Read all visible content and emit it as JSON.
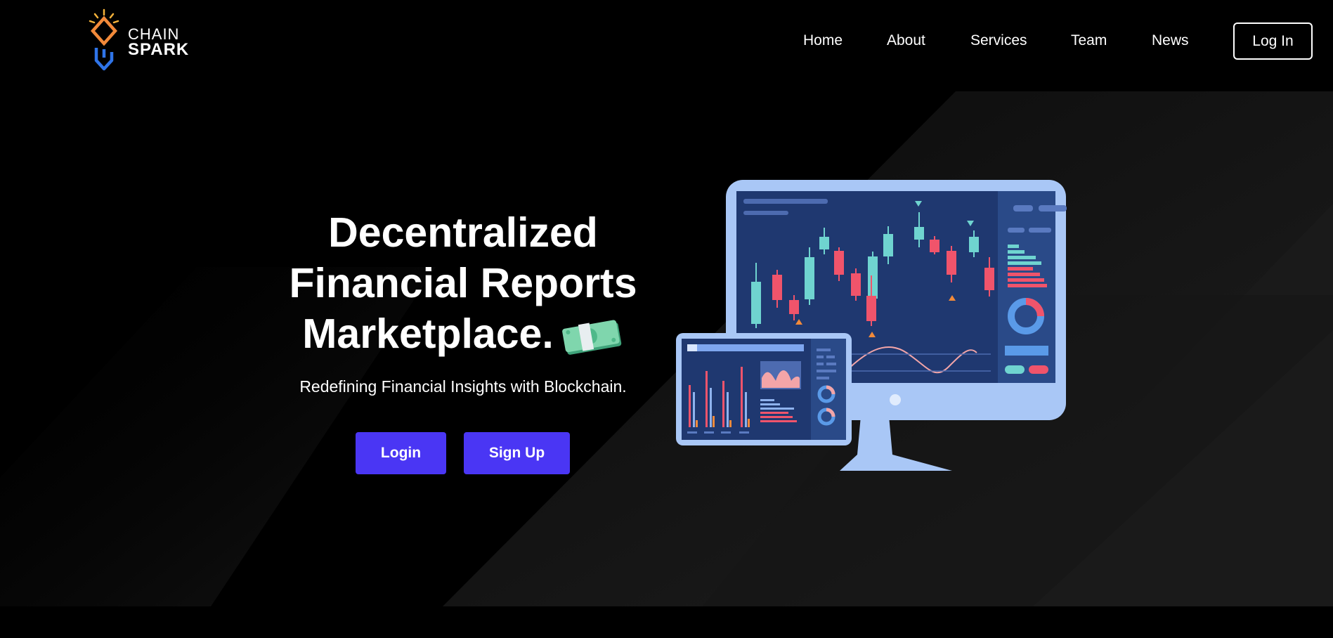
{
  "brand": {
    "line1": "CHAIN",
    "line2": "SPARK",
    "logo_icon": "chain-spark-logo"
  },
  "nav": {
    "items": [
      {
        "label": "Home"
      },
      {
        "label": "About"
      },
      {
        "label": "Services"
      },
      {
        "label": "Team"
      },
      {
        "label": "News"
      }
    ],
    "login_label": "Log In"
  },
  "hero": {
    "title_line1": "Decentralized",
    "title_line2": "Financial Reports",
    "title_line3": "Marketplace.",
    "title_icon": "money-bill-icon",
    "subtitle": "Redefining Financial Insights with Blockchain.",
    "login_button": "Login",
    "signup_button": "Sign Up"
  },
  "colors": {
    "background": "#000000",
    "accent": "#4a36f4",
    "monitor_frame": "#a9c7f6",
    "screen": "#1f3870",
    "candle_up": "#6fd4d0",
    "candle_down": "#f0546b"
  }
}
